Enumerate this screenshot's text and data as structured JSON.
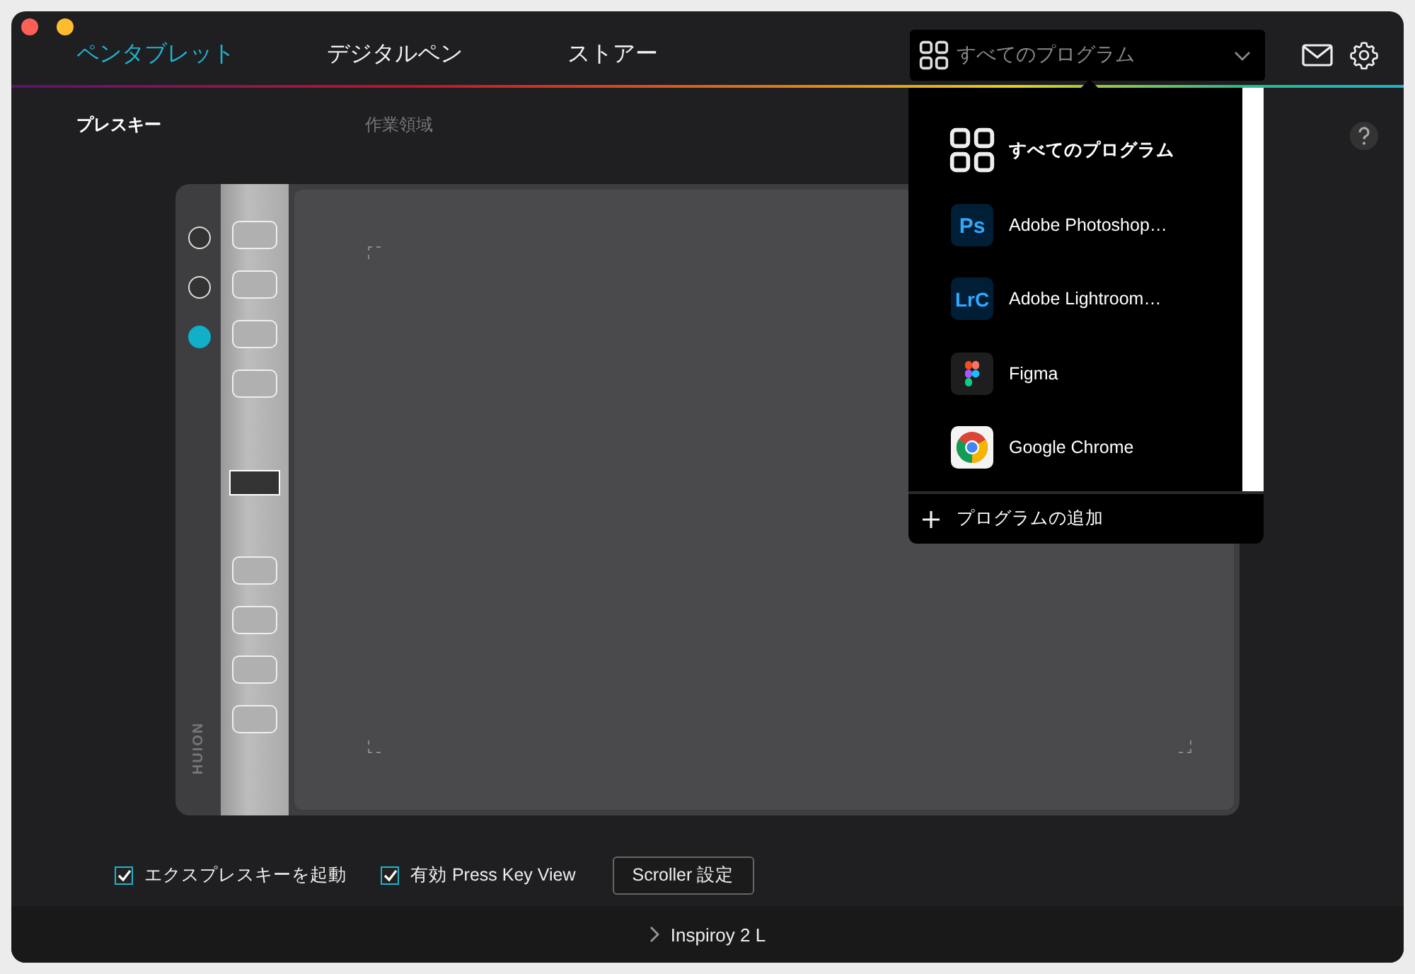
{
  "tabs": [
    {
      "label": "ペンタブレット",
      "selected": true
    },
    {
      "label": "デジタルペン",
      "selected": false
    },
    {
      "label": "ストアー",
      "selected": false
    }
  ],
  "program_select": {
    "value": "すべてのプログラム",
    "expanded": true
  },
  "program_menu": {
    "items": [
      {
        "kind": "all",
        "label": "すべてのプログラム"
      },
      {
        "kind": "photoshop",
        "icon_text": "Ps",
        "label": "Adobe Photoshop…"
      },
      {
        "kind": "lightroom",
        "icon_text": "LrC",
        "label": "Adobe Lightroom…"
      },
      {
        "kind": "figma",
        "label": "Figma"
      },
      {
        "kind": "chrome",
        "label": "Google Chrome"
      }
    ],
    "add_label": "プログラムの追加"
  },
  "subtabs": [
    {
      "label": "プレスキー",
      "selected": true
    },
    {
      "label": "作業領域",
      "selected": false
    }
  ],
  "tablet": {
    "brand": "HUION",
    "modes": [
      {
        "selected": false
      },
      {
        "selected": false
      },
      {
        "selected": true
      }
    ]
  },
  "options": [
    {
      "label": "エクスプレスキーを起動",
      "checked": true
    },
    {
      "label": "有効 Press Key View",
      "checked": true
    }
  ],
  "scroller_button": "Scroller 設定",
  "device": "Inspiroy 2 L"
}
